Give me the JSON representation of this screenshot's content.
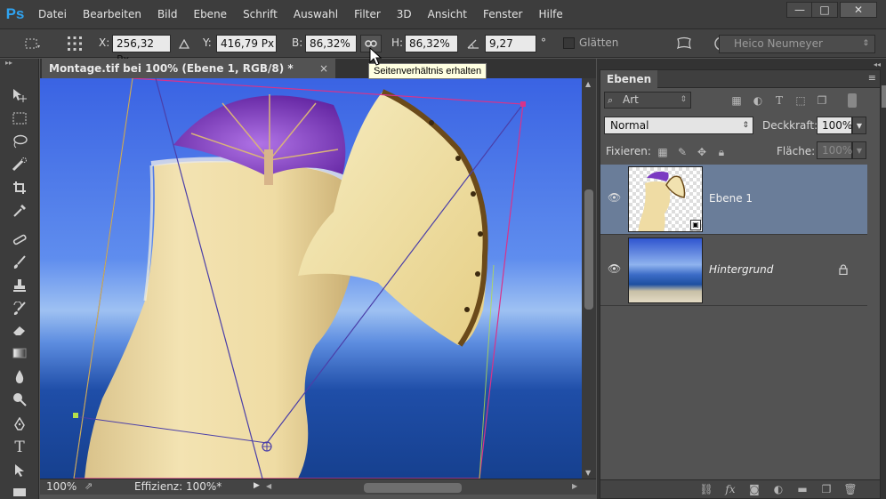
{
  "app": {
    "logo": "Ps"
  },
  "menu": [
    "Datei",
    "Bearbeiten",
    "Bild",
    "Ebene",
    "Schrift",
    "Auswahl",
    "Filter",
    "3D",
    "Ansicht",
    "Fenster",
    "Hilfe"
  ],
  "window_controls": {
    "minimize": "—",
    "maximize": "□",
    "close": "✕"
  },
  "options": {
    "x_label": "X:",
    "x_value": "256,32 Px",
    "y_label": "Y:",
    "y_value": "416,79 Px",
    "w_label": "B:",
    "w_value": "86,32%",
    "h_label": "H:",
    "h_value": "86,32%",
    "angle_value": "9,27",
    "angle_unit": "°",
    "smooth_label": "Glätten",
    "preset_label": "Heico Neumeyer"
  },
  "tooltip": "Seitenverhältnis erhalten",
  "document": {
    "tab_title": "Montage.tif bei 100% (Ebene 1, RGB/8) *",
    "close": "×",
    "zoom": "100%",
    "status": "Effizienz: 100%*"
  },
  "layers_panel": {
    "tab": "Ebenen",
    "filter_label": "Art",
    "blend_mode": "Normal",
    "opacity_label": "Deckkraft:",
    "opacity_value": "100%",
    "lock_label": "Fixieren:",
    "fill_label": "Fläche:",
    "fill_value": "100%",
    "layers": [
      {
        "name": "Ebene 1",
        "selected": true,
        "locked": false
      },
      {
        "name": "Hintergrund",
        "selected": false,
        "locked": true
      }
    ]
  },
  "colors": {
    "accent": "#2fa3f0",
    "selected_layer": "#6a7d99",
    "bounding_box": "#d8338a",
    "transform_line": "#4b3fa8"
  },
  "icons": {
    "tools": [
      "move-icon",
      "marquee-icon",
      "lasso-icon",
      "quick-select-icon",
      "crop-icon",
      "eyedropper-icon",
      "healing-icon",
      "brush-icon",
      "stamp-icon",
      "history-brush-icon",
      "eraser-icon",
      "gradient-icon",
      "blur-icon",
      "dodge-icon",
      "pen-icon",
      "type-icon",
      "path-select-icon",
      "shape-icon"
    ],
    "layer_panel_bottom": [
      "link-icon",
      "fx-icon",
      "mask-icon",
      "adjustment-icon",
      "folder-icon",
      "new-layer-icon",
      "trash-icon"
    ]
  }
}
